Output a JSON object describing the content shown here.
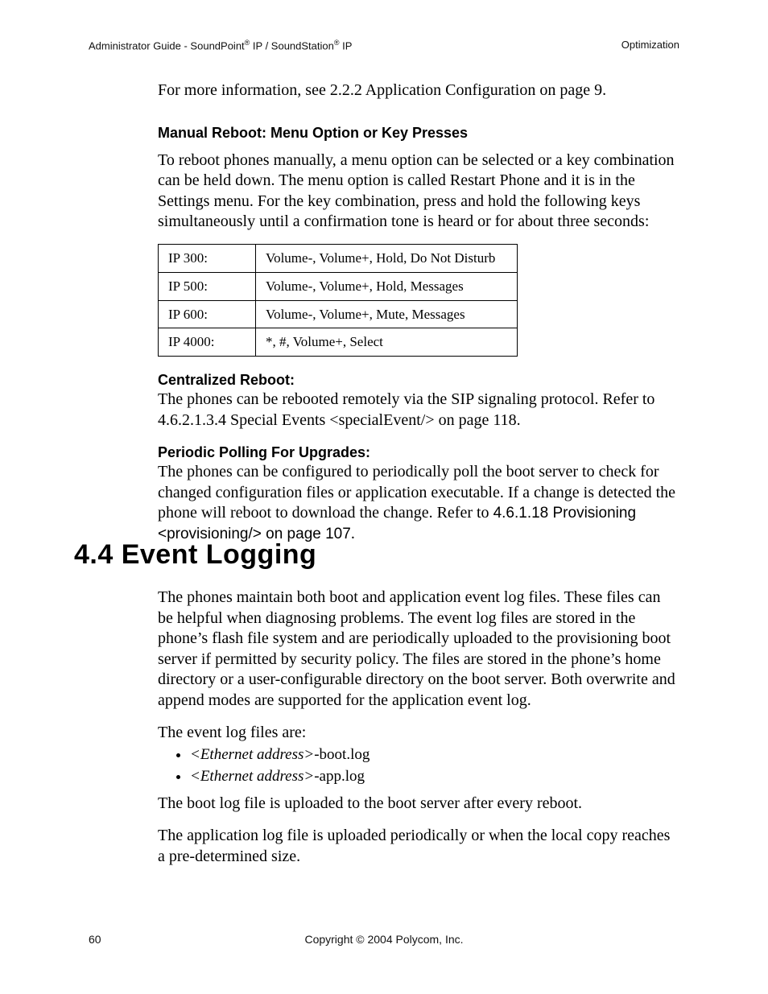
{
  "header": {
    "left_pre": "Administrator Guide - SoundPoint",
    "reg": "®",
    "left_mid": " IP / SoundStation",
    "left_tail": " IP",
    "right": "Optimization"
  },
  "intro_more_info": "For more information, see 2.2.2 Application Configuration on page 9.",
  "manual_reboot": {
    "heading": "Manual Reboot: Menu Option or Key Presses",
    "para": "To reboot phones manually, a menu option can be selected or a key combination can be held down. The menu option is called Restart Phone and it is in the Settings menu. For the key combination, press and hold the following keys simultaneously until a confirmation tone is heard or for about three seconds:",
    "rows": [
      {
        "model": "IP 300:",
        "keys": "Volume-, Volume+, Hold, Do Not Disturb"
      },
      {
        "model": "IP 500:",
        "keys": "Volume-, Volume+, Hold, Messages"
      },
      {
        "model": "IP 600:",
        "keys": "Volume-, Volume+, Mute, Messages"
      },
      {
        "model": "IP 4000:",
        "keys": "*, #, Volume+, Select"
      }
    ]
  },
  "centralized": {
    "heading": "Centralized Reboot:",
    "para": "The phones can be rebooted remotely via the SIP signaling protocol. Refer to 4.6.2.1.3.4 Special Events <specialEvent/> on page 118."
  },
  "polling": {
    "heading": "Periodic Polling For Upgrades:",
    "para_pre": "The phones can be configured to periodically poll the boot server to check for changed configuration files or application executable. If a change is detected the phone will reboot to download the change.  Refer to ",
    "para_sans": "4.6.1.18 Provisioning <provisioning/> on page 107",
    "para_post": "."
  },
  "section": {
    "number_title": "4.4  Event Logging"
  },
  "event_logging": {
    "p1": "The phones maintain both boot and application event log files.  These files can be helpful when diagnosing problems.  The event log files are stored in the phone’s flash file system and are periodically uploaded to the provisioning boot server if permitted by security policy.  The files are stored in the phone’s home directory or a user-configurable directory on the boot server.  Both overwrite and append modes are supported for the application event log.",
    "p2": "The event log files are:",
    "logs": [
      {
        "prefix_italic": "<Ethernet address>",
        "suffix": "-boot.log"
      },
      {
        "prefix_italic": "<Ethernet address>",
        "suffix": "-app.log"
      }
    ],
    "p3": "The boot log file is uploaded to the boot server after every reboot.",
    "p4": "The application log file is uploaded periodically or when the local copy reaches a pre-determined size."
  },
  "footer": {
    "page": "60",
    "copyright": "Copyright © 2004 Polycom, Inc."
  }
}
